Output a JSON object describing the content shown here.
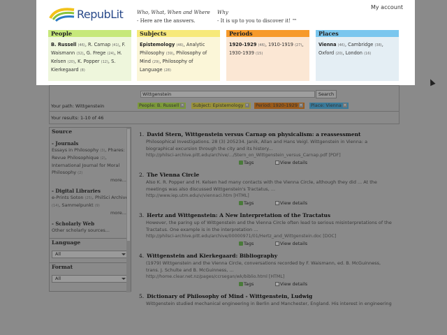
{
  "header": {
    "logo_text": "RepubLit",
    "tagline1_title": "Who, What, When and Where",
    "tagline1_text": "- Here are the answers.",
    "tagline2_title": "Why",
    "tagline2_text": "- It is up to you to discover it! ™",
    "account_link": "My account"
  },
  "categories": {
    "people": {
      "title": "People"
    },
    "subjects": {
      "title": "Subjects"
    },
    "periods": {
      "title": "Periods"
    },
    "places": {
      "title": "Places"
    }
  },
  "search": {
    "value": "Wittgenstein",
    "button": "Search",
    "path_label": "Your path: Wittgenstein",
    "filters": [
      "People: B. Russell",
      "Subject: Epistemology",
      "Period: 1920-1929",
      "Place: Vienna"
    ],
    "results_label": "Your results: 1-10 of 46"
  },
  "sidebar": {
    "source_title": "Source",
    "journals_title": "- Journals",
    "libraries_title": "- Digital Libraries",
    "web_title": "- Scholarly Web",
    "web_link": "Other scholarly sources...",
    "more": "more...",
    "language_title": "Language",
    "language_value": "All",
    "format_title": "Format",
    "format_value": "All"
  },
  "results": [
    {
      "num": "1.",
      "title": "David Stern, Wittgenstein versus Carnap on physicalism: a reassessment",
      "desc1": "Philosophical Investigations. 28 (3) 205234. Janik, Allan and Hans Veigl. Wittgenstein in Vienna: a",
      "desc2": "biographical excursion through the city and its history...",
      "url": "http://philsci-archive.pitt.edu/archive/.../Stern_on_Wittgenstein_versus_Carnap.pdf    [PDF]",
      "tags": "Tags",
      "view": "View details"
    },
    {
      "num": "2.",
      "title": "The Vienna Circle",
      "desc1": "Also K. R. Popper and H. Kelsen had many contacts with the Vienna Circle, although they did ... At the",
      "desc2": "meetings was also discussed Wittgenstein's Tractatus, ...",
      "url": "http://www.iep.utm.edu/v/viennaci.htm     [HTML]",
      "tags": "Tags",
      "view": "View details"
    },
    {
      "num": "3.",
      "title": "Hertz and Wittgenstein: A New Interpretation of the Tractatus",
      "desc1": "However, the paring up of Wittgenstein and the Vienna Circle often lead to serious misinterpretations of the",
      "desc2": "Tractatus. One example is in the interpretation ...",
      "url": "http://philsci-archive.pitt.edu/archive/00000971/01/Hertz_and_Wittgenstein.doc     [DOC]",
      "tags": "Tags",
      "view": "View details"
    },
    {
      "num": "4.",
      "title": "Wittgenstein and Kierkegaard: Bibliography",
      "desc1": "(1979) Wittgenstein and the Vienna Circle, conversations recorded by F. Waismann, ed. B. McGuinness,",
      "desc2": "trans. J. Schulte and B. McGuinness, ...",
      "url": "http://home.clear.net.nz/pages/ccrsegan/wk/biblio.html     [HTML]",
      "tags": "Tags",
      "view": "View details"
    },
    {
      "num": "5.",
      "title": "Dictionary of Philosophy of Mind - Wittgenstein, Ludwig",
      "desc1": "Wittgenstein studied mechanical engineering in Berlin and Manchester, England. His interest in engineering",
      "desc2": "",
      "url": "",
      "tags": "",
      "view": ""
    }
  ]
}
